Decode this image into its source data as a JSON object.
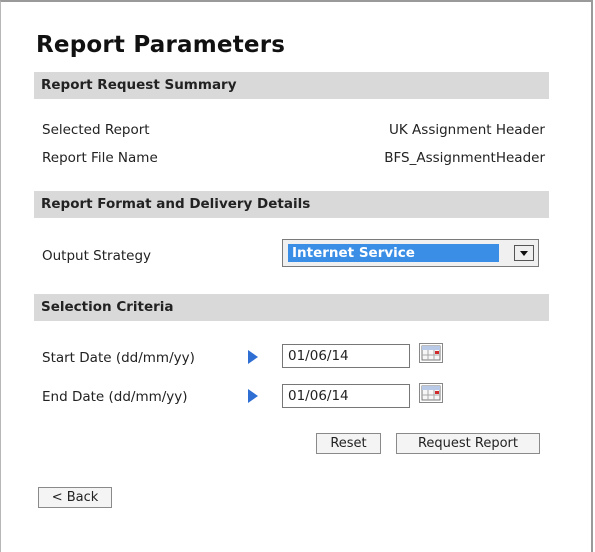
{
  "page": {
    "title": "Report Parameters"
  },
  "summary": {
    "header": "Report Request Summary",
    "selected_report_label": "Selected Report",
    "selected_report_value": "UK Assignment Header",
    "report_file_label": "Report File Name",
    "report_file_value": "BFS_AssignmentHeader"
  },
  "format": {
    "header": "Report Format and Delivery Details",
    "output_strategy_label": "Output Strategy",
    "output_strategy_value": "Internet Service"
  },
  "criteria": {
    "header": "Selection Criteria",
    "start_label": "Start Date (dd/mm/yy)",
    "start_value": "01/06/14",
    "end_label": "End Date (dd/mm/yy)",
    "end_value": "01/06/14"
  },
  "buttons": {
    "reset": "Reset",
    "request": "Request Report",
    "back": "< Back"
  },
  "icons": {
    "marker": "triangle-right-icon",
    "calendar": "calendar-icon",
    "dropdown": "chevron-down-icon"
  },
  "colors": {
    "section_bg": "#d9d9d9",
    "selected_bg": "#3a8ee6",
    "marker": "#2f6fd4"
  }
}
